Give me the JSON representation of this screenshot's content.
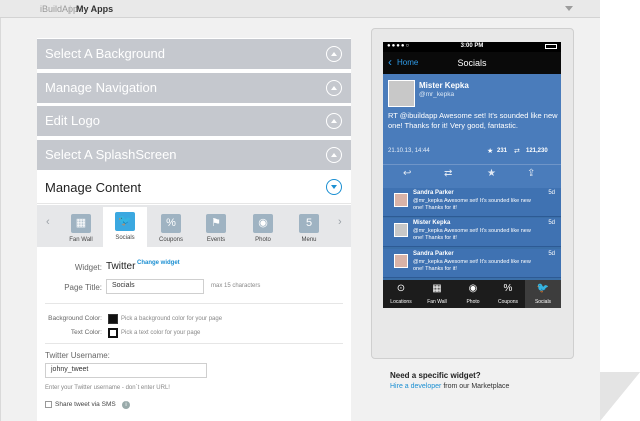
{
  "topbar": {
    "brand": "iBuildApp",
    "sep": "|",
    "current": "My Apps"
  },
  "accordion": [
    {
      "label": "Select A Background"
    },
    {
      "label": "Manage Navigation"
    },
    {
      "label": "Edit Logo"
    },
    {
      "label": "Select A SplashScreen"
    }
  ],
  "manage_content": {
    "label": "Manage Content"
  },
  "widget_tabs": [
    {
      "label": "Fan Wall",
      "icon": "fan-wall-icon",
      "glyph": "▦"
    },
    {
      "label": "Socials",
      "icon": "twitter-icon",
      "glyph": "🐦",
      "active": true
    },
    {
      "label": "Coupons",
      "icon": "coupons-icon",
      "glyph": "%"
    },
    {
      "label": "Events",
      "icon": "events-icon",
      "glyph": "⚑"
    },
    {
      "label": "Photo",
      "icon": "camera-icon",
      "glyph": "◉"
    },
    {
      "label": "Menu",
      "icon": "menu-icon",
      "glyph": "5"
    }
  ],
  "form": {
    "widget_label": "Widget:",
    "widget_value": "Twitter",
    "change_widget": "Change widget",
    "page_title_label": "Page Title:",
    "page_title_value": "Socials",
    "page_title_hint": "max 15 characters",
    "bg_color_label": "Background Color:",
    "bg_color_hint": "Pick a background color for your page",
    "text_color_label": "Text Color:",
    "text_color_hint": "Pick a text color for your page",
    "username_label": "Twitter Username:",
    "username_value": "johny_tweet",
    "username_hint": "Enter your Twitter username - don`t enter URL!",
    "share_label": "Share tweet via SMS"
  },
  "phone": {
    "time": "3:00 PM",
    "nav_back": "Home",
    "nav_title": "Socials",
    "main_tweet": {
      "name": "Mister Kepka",
      "handle": "@mr_kepka",
      "text": "RT @ibuildapp  Awesome set! It's sounded like new one! Thanks for it! Very good, fantastic.",
      "date": "21.10.13, 14:44",
      "favorites": "231",
      "retweets": "121,230"
    },
    "tweets": [
      {
        "name": "Sandra Parker",
        "age": "5d",
        "text": "@mr_kepka Awesome set! It's sounded like new one! Thanks for it!"
      },
      {
        "name": "Mister Kepka",
        "age": "5d",
        "text": "@mr_kepka Awesome set! It's sounded like new one! Thanks for it!"
      },
      {
        "name": "Sandra Parker",
        "age": "5d",
        "text": "@mr_kepka Awesome set! It's sounded like new one! Thanks for it!"
      }
    ],
    "tabbar": [
      {
        "label": "Locations",
        "glyph": "⊙"
      },
      {
        "label": "Fan Wall",
        "glyph": "▦"
      },
      {
        "label": "Photo",
        "glyph": "◉"
      },
      {
        "label": "Coupons",
        "glyph": "%"
      },
      {
        "label": "Socials",
        "glyph": "🐦",
        "active": true
      }
    ]
  },
  "promo": {
    "title": "Need a specific widget?",
    "link": "Hire a developer",
    "rest": " from our Marketplace"
  }
}
